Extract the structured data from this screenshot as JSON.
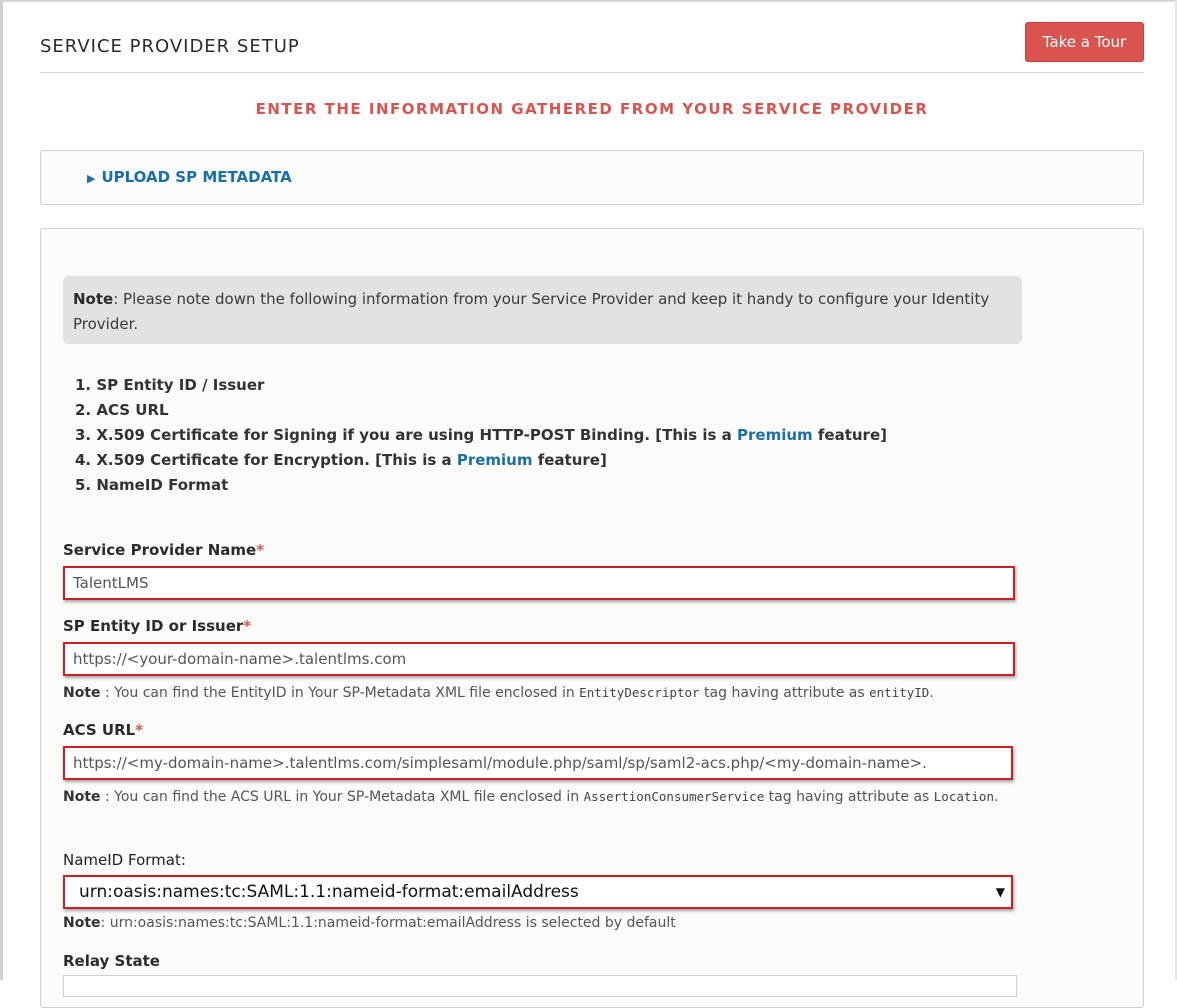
{
  "header": {
    "title": "SERVICE PROVIDER SETUP",
    "tour_button": "Take a Tour",
    "subtitle": "ENTER THE INFORMATION GATHERED FROM YOUR SERVICE PROVIDER"
  },
  "upload": {
    "arrow": "▶",
    "label": "UPLOAD SP METADATA"
  },
  "note": {
    "prefix": "Note",
    "text": ": Please note down the following information from your Service Provider and keep it handy to configure your Identity Provider."
  },
  "requirements": [
    "1. SP Entity ID / Issuer",
    "2. ACS URL",
    {
      "before": "3. X.509 Certificate for Signing if you are using HTTP-POST Binding. [This is a ",
      "link": "Premium",
      "after": " feature]"
    },
    {
      "before": "4. X.509 Certificate for Encryption. [This is a ",
      "link": "Premium",
      "after": " feature]"
    },
    "5. NameID Format"
  ],
  "form": {
    "required_mark": "*",
    "sp_name": {
      "label": "Service Provider Name",
      "value": "TalentLMS"
    },
    "entity_id": {
      "label": "SP Entity ID or Issuer",
      "value": "https://<your-domain-name>.talentlms.com",
      "hint_note": "Note",
      "hint_text1": " : You can find the EntityID in Your SP-Metadata XML file enclosed in ",
      "hint_code1": "EntityDescriptor",
      "hint_text2": " tag having attribute as ",
      "hint_code2": "entityID",
      "hint_text3": "."
    },
    "acs_url": {
      "label": "ACS URL",
      "value": "https://<my-domain-name>.talentlms.com/simplesaml/module.php/saml/sp/saml2-acs.php/<my-domain-name>.",
      "hint_note": "Note",
      "hint_text1": " : You can find the ACS URL in Your SP-Metadata XML file enclosed in ",
      "hint_code1": "AssertionConsumerService",
      "hint_text2": "  tag having attribute as ",
      "hint_code2": "Location",
      "hint_text3": "."
    },
    "nameid": {
      "label": "NameID Format:",
      "value": "urn:oasis:names:tc:SAML:1.1:nameid-format:emailAddress",
      "hint_note": "Note",
      "hint_text": ": urn:oasis:names:tc:SAML:1.1:nameid-format:emailAddress is selected by default"
    },
    "relay_state": {
      "label": "Relay State"
    }
  }
}
